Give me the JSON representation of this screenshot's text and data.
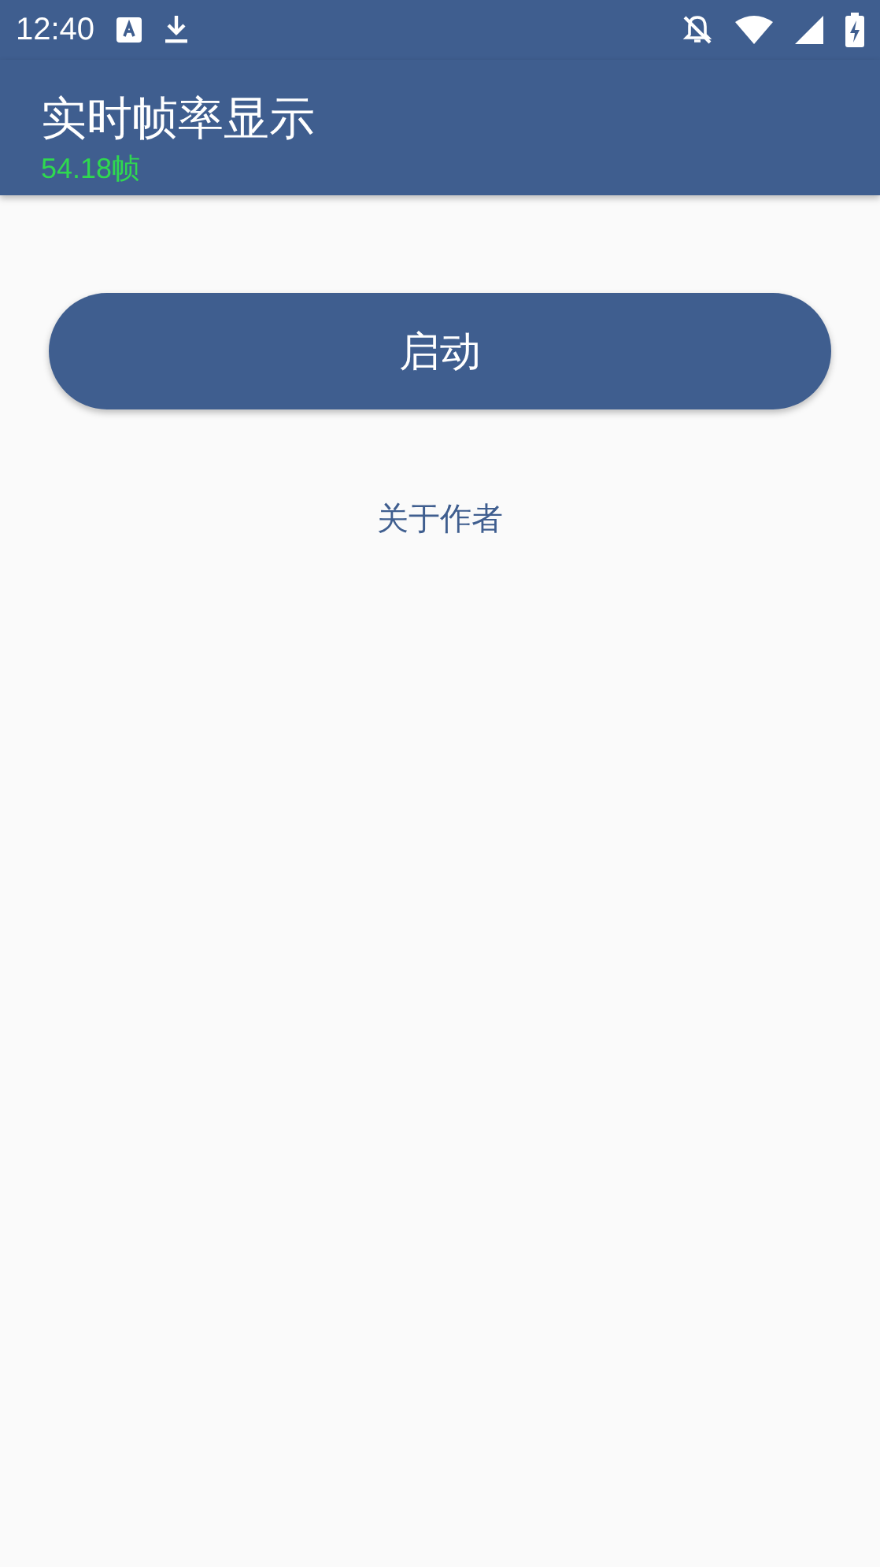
{
  "status_bar": {
    "time": "12:40"
  },
  "app_bar": {
    "title": "实时帧率显示"
  },
  "fps_overlay": {
    "text": "54.18帧"
  },
  "start_button": {
    "label": "启动"
  },
  "about_link": {
    "label": "关于作者"
  }
}
